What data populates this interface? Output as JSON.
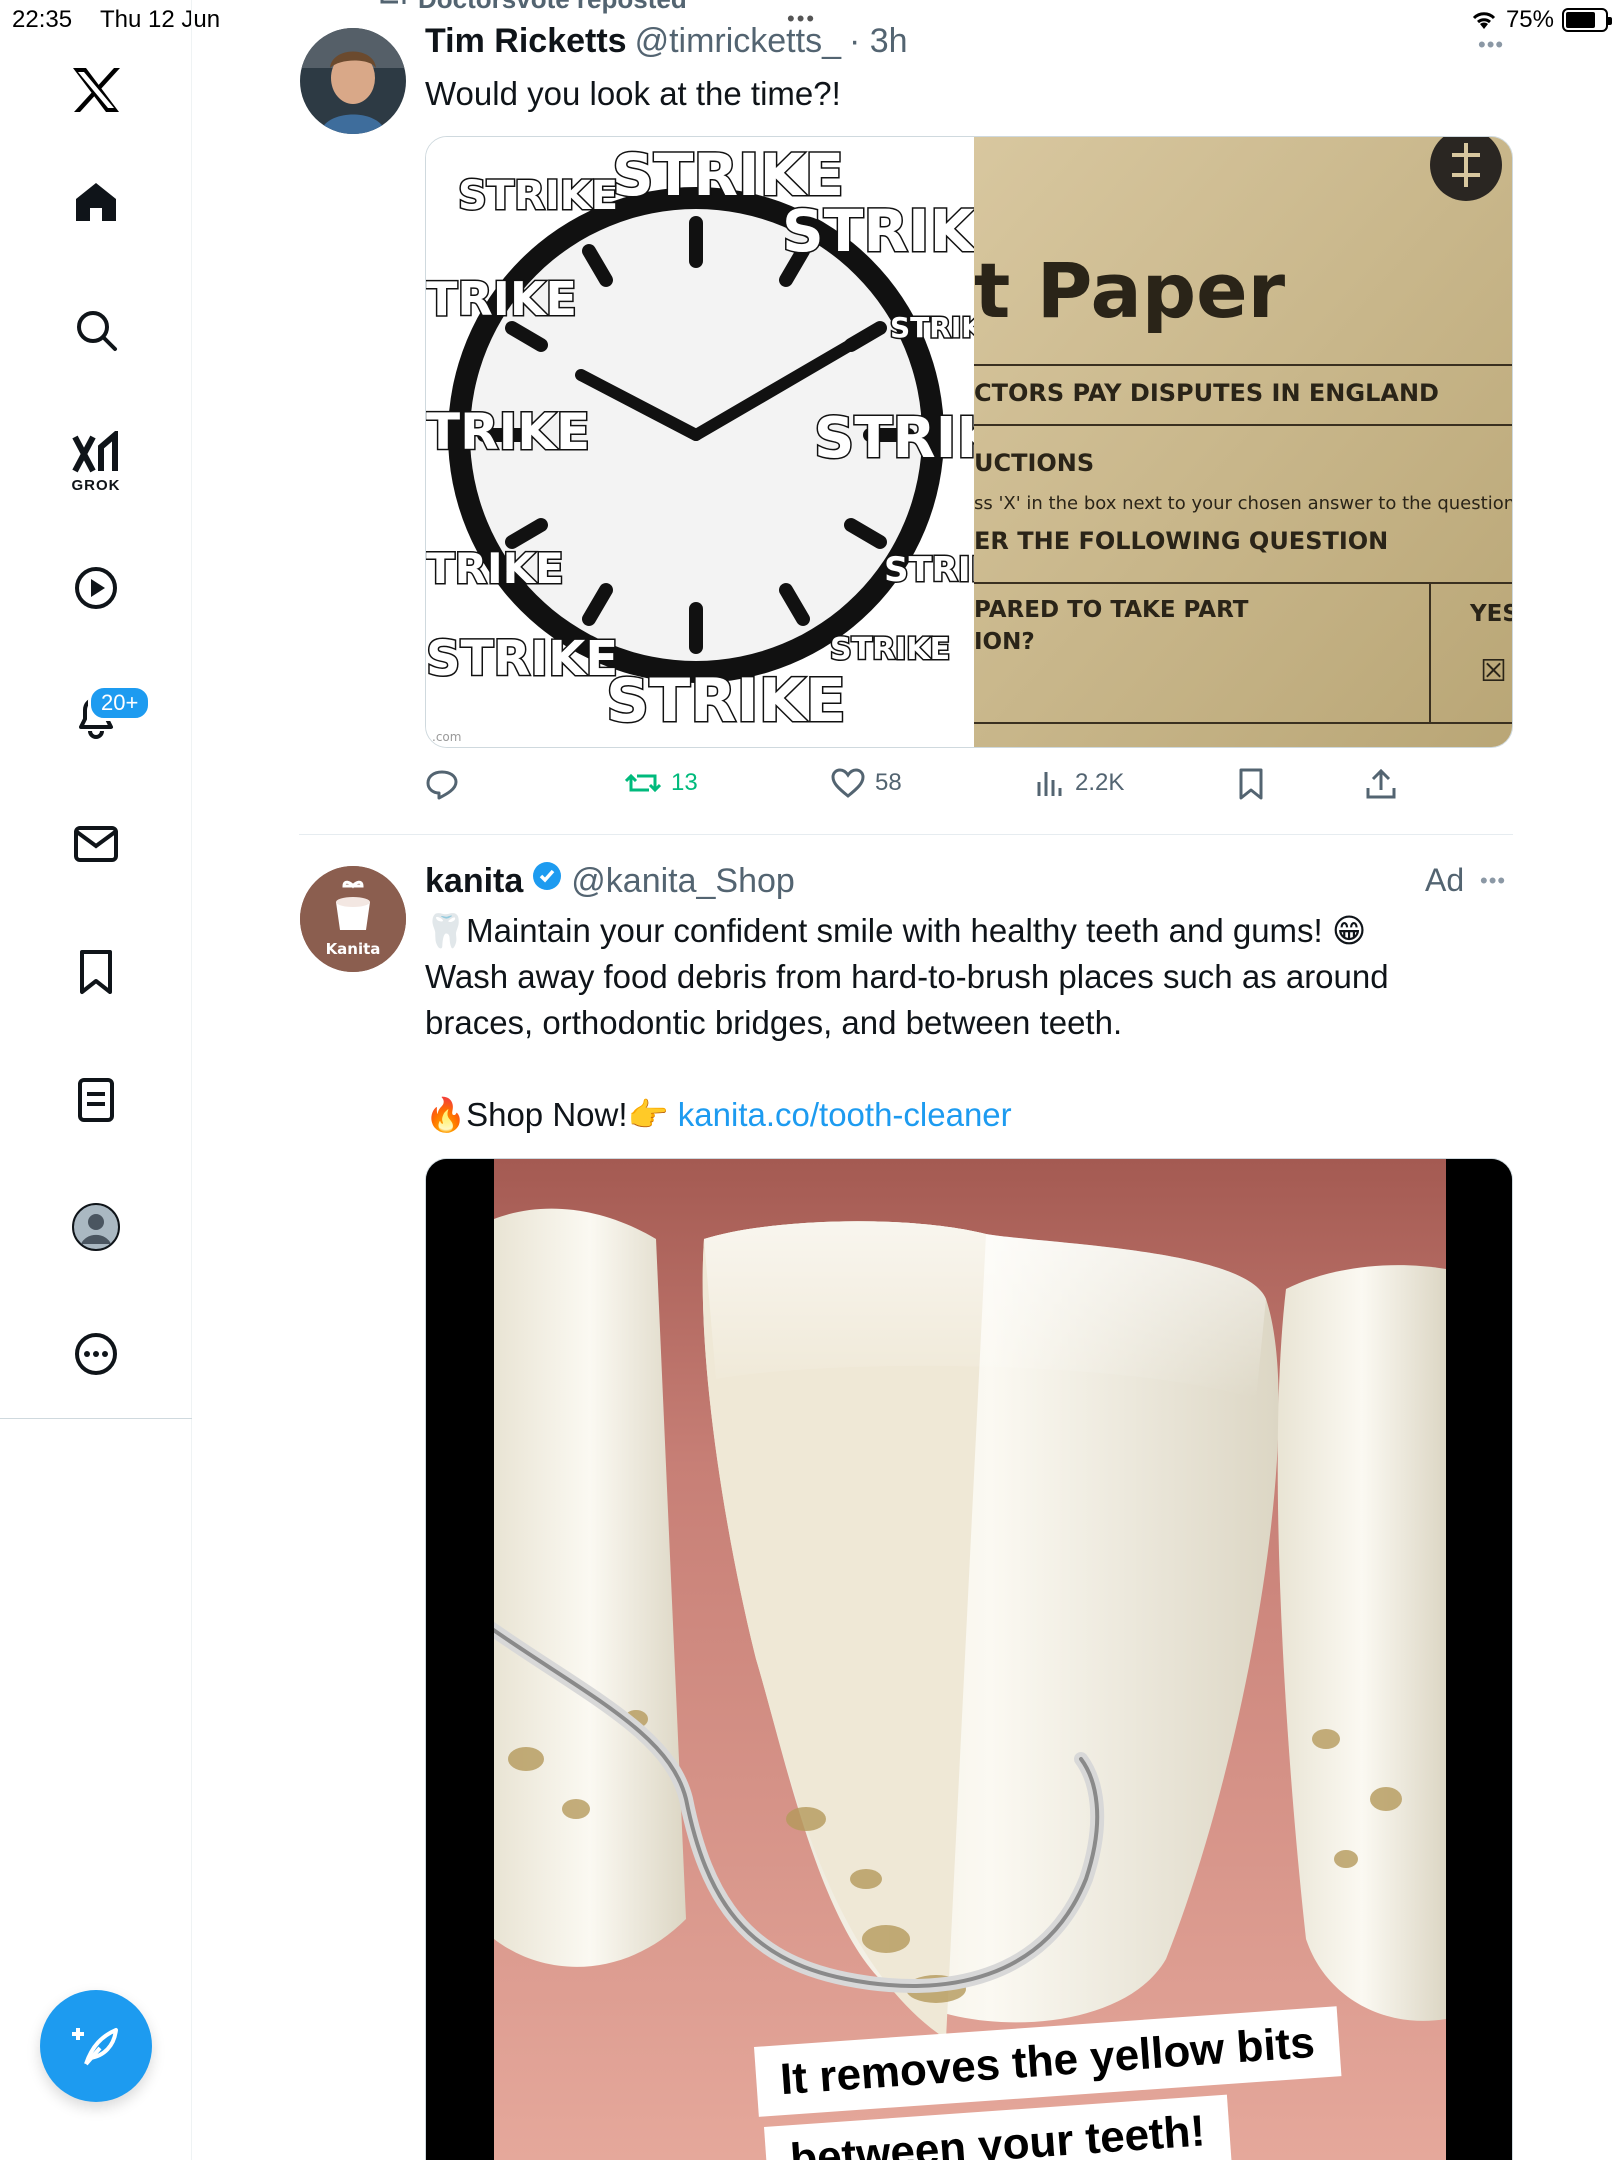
{
  "status_bar": {
    "time": "22:35",
    "date": "Thu 12 Jun",
    "battery_text": "75%",
    "battery_level": 0.75
  },
  "sidebar": {
    "notifications_badge": "20+",
    "grok_label": "GROK"
  },
  "feed": {
    "repost_banner": "Doctorsvote reposted",
    "tweet1": {
      "name": "Tim Ricketts",
      "handle": "@timricketts_",
      "time": "· 3h",
      "text": "Would you look at the time?!",
      "media": {
        "clock_words": [
          "STRIKE",
          "STRIKE",
          "STRIKE",
          "TRIKE",
          "STRIK",
          "TRIKE",
          "STRIK",
          "TRIKE",
          "STRIK",
          "STRIKE",
          "STRIKE",
          "STRIKE"
        ],
        "clock_footer": ".com",
        "paper_title": "t Paper",
        "paper_subtitle": "CTORS PAY DISPUTES IN ENGLAND",
        "paper_section": "UCTIONS",
        "paper_instruction": "ss 'X' in the box next to your chosen answer to the question.",
        "paper_question_header": "ER THE FOLLOWING QUESTION",
        "paper_question_1": "PARED TO TAKE PART",
        "paper_question_2": "ION?",
        "paper_yes": "YES",
        "paper_mark": "☒"
      },
      "stats": {
        "reposts": "13",
        "likes": "58",
        "views": "2.2K"
      }
    },
    "tweet2": {
      "name": "kanita",
      "handle": "@kanita_Shop",
      "ad_label": "Ad",
      "avatar_text": "Kanita",
      "line1": "🦷Maintain your confident smile with healthy teeth and gums! 😁",
      "line2": "Wash away food debris from hard-to-brush places such as around",
      "line3": "braces, orthodontic bridges, and between teeth.",
      "shop_prefix": "🔥Shop Now!👉 ",
      "shop_link": "kanita.co/tooth-cleaner",
      "video_caption_1": "It removes the yellow bits",
      "video_caption_2": "between your teeth!"
    }
  },
  "colors": {
    "accent": "#1d9bf0",
    "repost_green": "#00ba7c",
    "secondary_text": "#536471"
  }
}
